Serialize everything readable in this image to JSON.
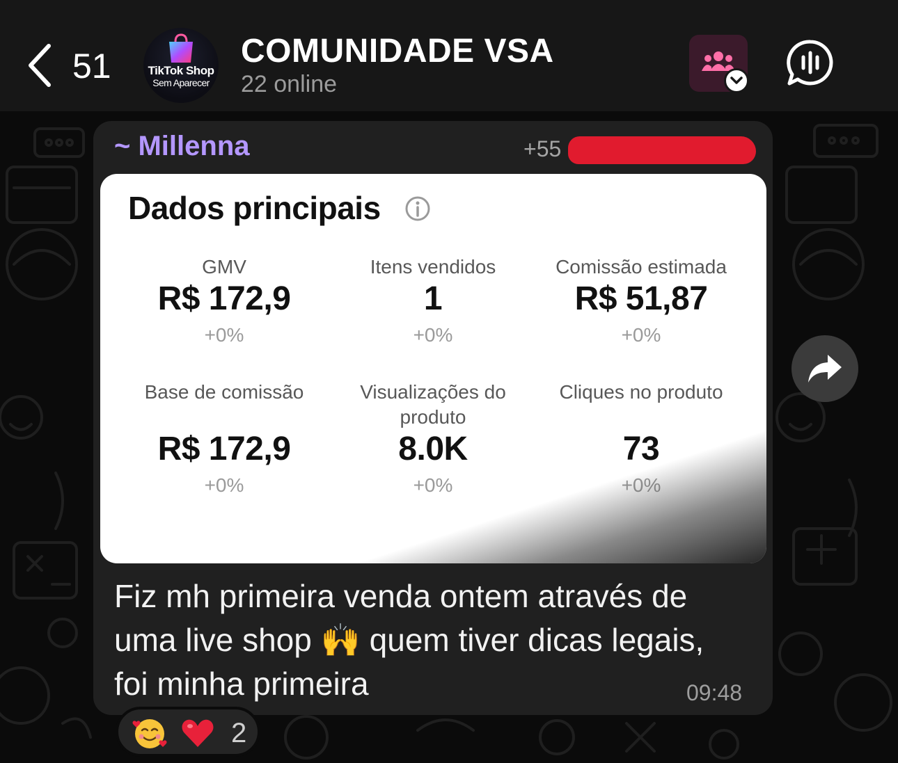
{
  "header": {
    "back_icon": "chevron-left-icon",
    "unread_count": "51",
    "avatar": {
      "line1": "TikTok Shop",
      "line2": "Sem Aparecer"
    },
    "title": "COMUNIDADE VSA",
    "subtitle": "22 online",
    "group_icon": "group-people-icon",
    "voice_icon": "voice-chat-icon",
    "accent": "#3b1a2b"
  },
  "message": {
    "sender": "~ Millenna",
    "phone_prefix": "+55",
    "sender_color": "#b497ff",
    "redaction_color": "#e11b2e",
    "image": {
      "title": "Dados principais",
      "metrics": [
        {
          "label": "GMV",
          "value": "R$ 172,9",
          "delta": "+0%"
        },
        {
          "label": "Itens vendidos",
          "value": "1",
          "delta": "+0%"
        },
        {
          "label": "Comissão estimada",
          "value": "R$ 51,87",
          "delta": "+0%"
        },
        {
          "label": "Base de comissão",
          "value": "R$ 172,9",
          "delta": "+0%"
        },
        {
          "label": "Visualizações do produto",
          "value": "8.0K",
          "delta": "+0%"
        },
        {
          "label": "Cliques no produto",
          "value": "73",
          "delta": "+0%"
        }
      ]
    },
    "text_lines": [
      "Fiz mh primeira venda ontem através de",
      "uma live shop 🙌 quem tiver dicas legais,",
      "foi minha primeira"
    ],
    "time": "09:48"
  },
  "forward_icon": "forward-arrow-icon",
  "reactions": {
    "emojis": [
      "🥰",
      "❤️"
    ],
    "count": "2"
  }
}
